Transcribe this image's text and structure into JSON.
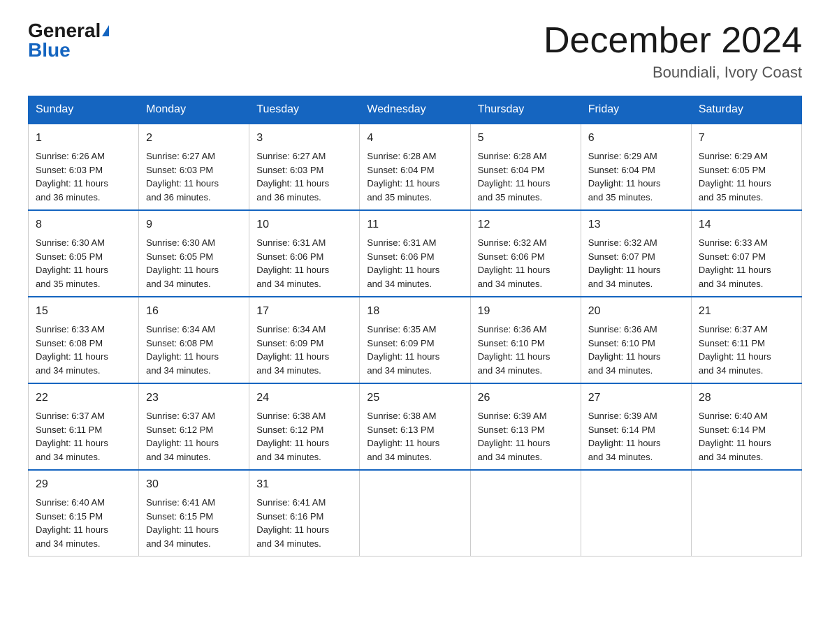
{
  "header": {
    "logo_general": "General",
    "logo_blue": "Blue",
    "month_title": "December 2024",
    "location": "Boundiali, Ivory Coast"
  },
  "days_of_week": [
    "Sunday",
    "Monday",
    "Tuesday",
    "Wednesday",
    "Thursday",
    "Friday",
    "Saturday"
  ],
  "weeks": [
    [
      {
        "day": "1",
        "sunrise": "6:26 AM",
        "sunset": "6:03 PM",
        "daylight": "11 hours and 36 minutes."
      },
      {
        "day": "2",
        "sunrise": "6:27 AM",
        "sunset": "6:03 PM",
        "daylight": "11 hours and 36 minutes."
      },
      {
        "day": "3",
        "sunrise": "6:27 AM",
        "sunset": "6:03 PM",
        "daylight": "11 hours and 36 minutes."
      },
      {
        "day": "4",
        "sunrise": "6:28 AM",
        "sunset": "6:04 PM",
        "daylight": "11 hours and 35 minutes."
      },
      {
        "day": "5",
        "sunrise": "6:28 AM",
        "sunset": "6:04 PM",
        "daylight": "11 hours and 35 minutes."
      },
      {
        "day": "6",
        "sunrise": "6:29 AM",
        "sunset": "6:04 PM",
        "daylight": "11 hours and 35 minutes."
      },
      {
        "day": "7",
        "sunrise": "6:29 AM",
        "sunset": "6:05 PM",
        "daylight": "11 hours and 35 minutes."
      }
    ],
    [
      {
        "day": "8",
        "sunrise": "6:30 AM",
        "sunset": "6:05 PM",
        "daylight": "11 hours and 35 minutes."
      },
      {
        "day": "9",
        "sunrise": "6:30 AM",
        "sunset": "6:05 PM",
        "daylight": "11 hours and 34 minutes."
      },
      {
        "day": "10",
        "sunrise": "6:31 AM",
        "sunset": "6:06 PM",
        "daylight": "11 hours and 34 minutes."
      },
      {
        "day": "11",
        "sunrise": "6:31 AM",
        "sunset": "6:06 PM",
        "daylight": "11 hours and 34 minutes."
      },
      {
        "day": "12",
        "sunrise": "6:32 AM",
        "sunset": "6:06 PM",
        "daylight": "11 hours and 34 minutes."
      },
      {
        "day": "13",
        "sunrise": "6:32 AM",
        "sunset": "6:07 PM",
        "daylight": "11 hours and 34 minutes."
      },
      {
        "day": "14",
        "sunrise": "6:33 AM",
        "sunset": "6:07 PM",
        "daylight": "11 hours and 34 minutes."
      }
    ],
    [
      {
        "day": "15",
        "sunrise": "6:33 AM",
        "sunset": "6:08 PM",
        "daylight": "11 hours and 34 minutes."
      },
      {
        "day": "16",
        "sunrise": "6:34 AM",
        "sunset": "6:08 PM",
        "daylight": "11 hours and 34 minutes."
      },
      {
        "day": "17",
        "sunrise": "6:34 AM",
        "sunset": "6:09 PM",
        "daylight": "11 hours and 34 minutes."
      },
      {
        "day": "18",
        "sunrise": "6:35 AM",
        "sunset": "6:09 PM",
        "daylight": "11 hours and 34 minutes."
      },
      {
        "day": "19",
        "sunrise": "6:36 AM",
        "sunset": "6:10 PM",
        "daylight": "11 hours and 34 minutes."
      },
      {
        "day": "20",
        "sunrise": "6:36 AM",
        "sunset": "6:10 PM",
        "daylight": "11 hours and 34 minutes."
      },
      {
        "day": "21",
        "sunrise": "6:37 AM",
        "sunset": "6:11 PM",
        "daylight": "11 hours and 34 minutes."
      }
    ],
    [
      {
        "day": "22",
        "sunrise": "6:37 AM",
        "sunset": "6:11 PM",
        "daylight": "11 hours and 34 minutes."
      },
      {
        "day": "23",
        "sunrise": "6:37 AM",
        "sunset": "6:12 PM",
        "daylight": "11 hours and 34 minutes."
      },
      {
        "day": "24",
        "sunrise": "6:38 AM",
        "sunset": "6:12 PM",
        "daylight": "11 hours and 34 minutes."
      },
      {
        "day": "25",
        "sunrise": "6:38 AM",
        "sunset": "6:13 PM",
        "daylight": "11 hours and 34 minutes."
      },
      {
        "day": "26",
        "sunrise": "6:39 AM",
        "sunset": "6:13 PM",
        "daylight": "11 hours and 34 minutes."
      },
      {
        "day": "27",
        "sunrise": "6:39 AM",
        "sunset": "6:14 PM",
        "daylight": "11 hours and 34 minutes."
      },
      {
        "day": "28",
        "sunrise": "6:40 AM",
        "sunset": "6:14 PM",
        "daylight": "11 hours and 34 minutes."
      }
    ],
    [
      {
        "day": "29",
        "sunrise": "6:40 AM",
        "sunset": "6:15 PM",
        "daylight": "11 hours and 34 minutes."
      },
      {
        "day": "30",
        "sunrise": "6:41 AM",
        "sunset": "6:15 PM",
        "daylight": "11 hours and 34 minutes."
      },
      {
        "day": "31",
        "sunrise": "6:41 AM",
        "sunset": "6:16 PM",
        "daylight": "11 hours and 34 minutes."
      },
      null,
      null,
      null,
      null
    ]
  ]
}
